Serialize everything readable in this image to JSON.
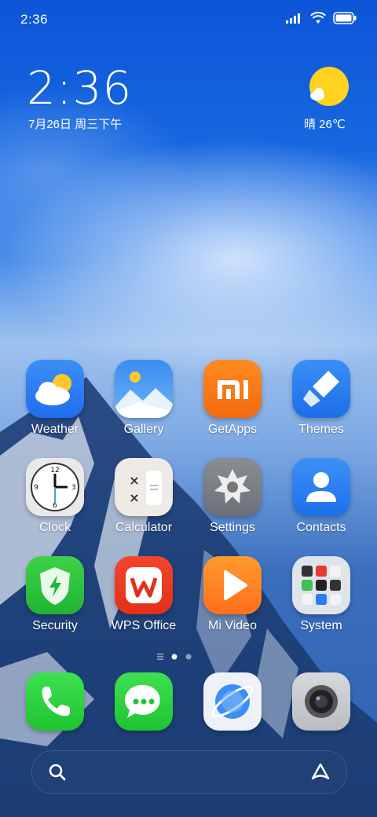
{
  "status_bar": {
    "time": "2:36",
    "icons": [
      "signal-icon",
      "wifi-icon",
      "battery-icon"
    ]
  },
  "clock_widget": {
    "time": "2:36",
    "date": "7月26日 周三下午"
  },
  "weather_widget": {
    "icon": "sun-cloud-icon",
    "text": "晴 26℃"
  },
  "apps": [
    {
      "label": "Weather",
      "icon": "weather-icon"
    },
    {
      "label": "Gallery",
      "icon": "gallery-icon"
    },
    {
      "label": "GetApps",
      "icon": "getapps-icon"
    },
    {
      "label": "Themes",
      "icon": "themes-icon"
    },
    {
      "label": "Clock",
      "icon": "clock-icon"
    },
    {
      "label": "Calculator",
      "icon": "calculator-icon"
    },
    {
      "label": "Settings",
      "icon": "settings-icon"
    },
    {
      "label": "Contacts",
      "icon": "contacts-icon"
    },
    {
      "label": "Security",
      "icon": "security-icon"
    },
    {
      "label": "WPS Office",
      "icon": "wps-office-icon"
    },
    {
      "label": "Mi Video",
      "icon": "mi-video-icon"
    },
    {
      "label": "System",
      "icon": "system-folder-icon"
    }
  ],
  "page_indicator": {
    "current": 1,
    "pages": 2
  },
  "dock": [
    {
      "icon": "phone-icon"
    },
    {
      "icon": "messages-icon"
    },
    {
      "icon": "browser-icon"
    },
    {
      "icon": "camera-icon"
    }
  ],
  "search_bar": {
    "left_icon": "search-icon",
    "right_icon": "assistant-icon"
  },
  "colors": {
    "wallpaper_top": "#0d55d8",
    "text": "#ffffff"
  }
}
